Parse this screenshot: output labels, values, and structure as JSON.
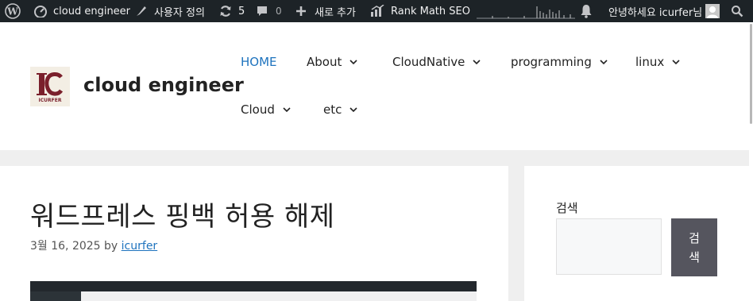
{
  "admin_bar": {
    "site_name": "cloud engineer",
    "customize": "사용자 정의",
    "updates_count": "5",
    "comments_count": "0",
    "new_label": "새로 추가",
    "rank_math": "Rank Math SEO",
    "greeting": "안녕하세요 icurfer님"
  },
  "header": {
    "logo_text": "ICURFER",
    "site_title": "cloud engineer",
    "nav": [
      "HOME",
      "About",
      "CloudNative",
      "programming",
      "linux",
      "Cloud",
      "etc"
    ]
  },
  "post": {
    "title": "워드프레스 핑백 허용 해제",
    "date": "3월 16, 2025",
    "by": "by",
    "author": "icurfer"
  },
  "sidebar": {
    "search_label": "검색",
    "search_button": "검색"
  },
  "colors": {
    "admin_bar": "#1d2327",
    "accent": "#1e73be",
    "button": "#55555e"
  }
}
